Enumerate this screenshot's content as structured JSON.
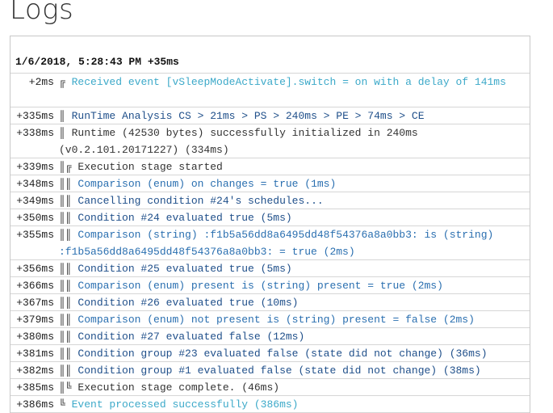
{
  "page": {
    "title": "Logs"
  },
  "log": {
    "header": "1/6/2018, 5:28:43 PM +35ms",
    "rows": [
      {
        "time": "+2ms",
        "prefix": "╔",
        "text": "Received event [vSleepModeActivate].switch = on with a delay of 141ms",
        "style": "cyan",
        "lines": 2
      },
      {
        "time": "+335ms",
        "prefix": "║",
        "text": "RunTime Analysis CS > 21ms > PS > 240ms > PE > 74ms > CE",
        "style": "dark",
        "lines": 1
      },
      {
        "time": "+338ms",
        "prefix": "║",
        "text": "Runtime (42530 bytes) successfully initialized in 240ms (v0.2.101.20171227) (334ms)",
        "style": "plain",
        "lines": 2
      },
      {
        "time": "+339ms",
        "prefix": "║╔",
        "text": "Execution stage started",
        "style": "plain",
        "lines": 1
      },
      {
        "time": "+348ms",
        "prefix": "║║",
        "text": "Comparison (enum) on changes = true (1ms)",
        "style": "link",
        "lines": 1
      },
      {
        "time": "+349ms",
        "prefix": "║║",
        "text": "Cancelling condition #24's schedules...",
        "style": "dark",
        "lines": 1
      },
      {
        "time": "+350ms",
        "prefix": "║║",
        "text": "Condition #24 evaluated true (5ms)",
        "style": "dark",
        "lines": 1
      },
      {
        "time": "+355ms",
        "prefix": "║║",
        "text": "Comparison (string) :f1b5a56dd8a6495dd48f54376a8a0bb3: is (string) :f1b5a56dd8a6495dd48f54376a8a0bb3: = true (2ms)",
        "style": "link",
        "lines": 2
      },
      {
        "time": "+356ms",
        "prefix": "║║",
        "text": "Condition #25 evaluated true (5ms)",
        "style": "dark",
        "lines": 1
      },
      {
        "time": "+366ms",
        "prefix": "║║",
        "text": "Comparison (enum) present is (string) present = true (2ms)",
        "style": "link",
        "lines": 1
      },
      {
        "time": "+367ms",
        "prefix": "║║",
        "text": "Condition #26 evaluated true (10ms)",
        "style": "dark",
        "lines": 1
      },
      {
        "time": "+379ms",
        "prefix": "║║",
        "text": "Comparison (enum) not present is (string) present = false (2ms)",
        "style": "link",
        "lines": 1
      },
      {
        "time": "+380ms",
        "prefix": "║║",
        "text": "Condition #27 evaluated false (12ms)",
        "style": "dark",
        "lines": 1
      },
      {
        "time": "+381ms",
        "prefix": "║║",
        "text": "Condition group #23 evaluated false (state did not change) (36ms)",
        "style": "dark",
        "lines": 1
      },
      {
        "time": "+382ms",
        "prefix": "║║",
        "text": "Condition group #1 evaluated false (state did not change) (38ms)",
        "style": "dark",
        "lines": 1
      },
      {
        "time": "+385ms",
        "prefix": "║╚",
        "text": "Execution stage complete. (46ms)",
        "style": "plain",
        "lines": 1
      },
      {
        "time": "+386ms",
        "prefix": "╚",
        "text": "Event processed successfully (386ms)",
        "style": "cyan",
        "lines": 1
      }
    ]
  },
  "colors": {
    "cyan": "#3ca9c9",
    "link": "#2a6fb0",
    "dark": "#1f4f8a",
    "plain": "#333333"
  }
}
